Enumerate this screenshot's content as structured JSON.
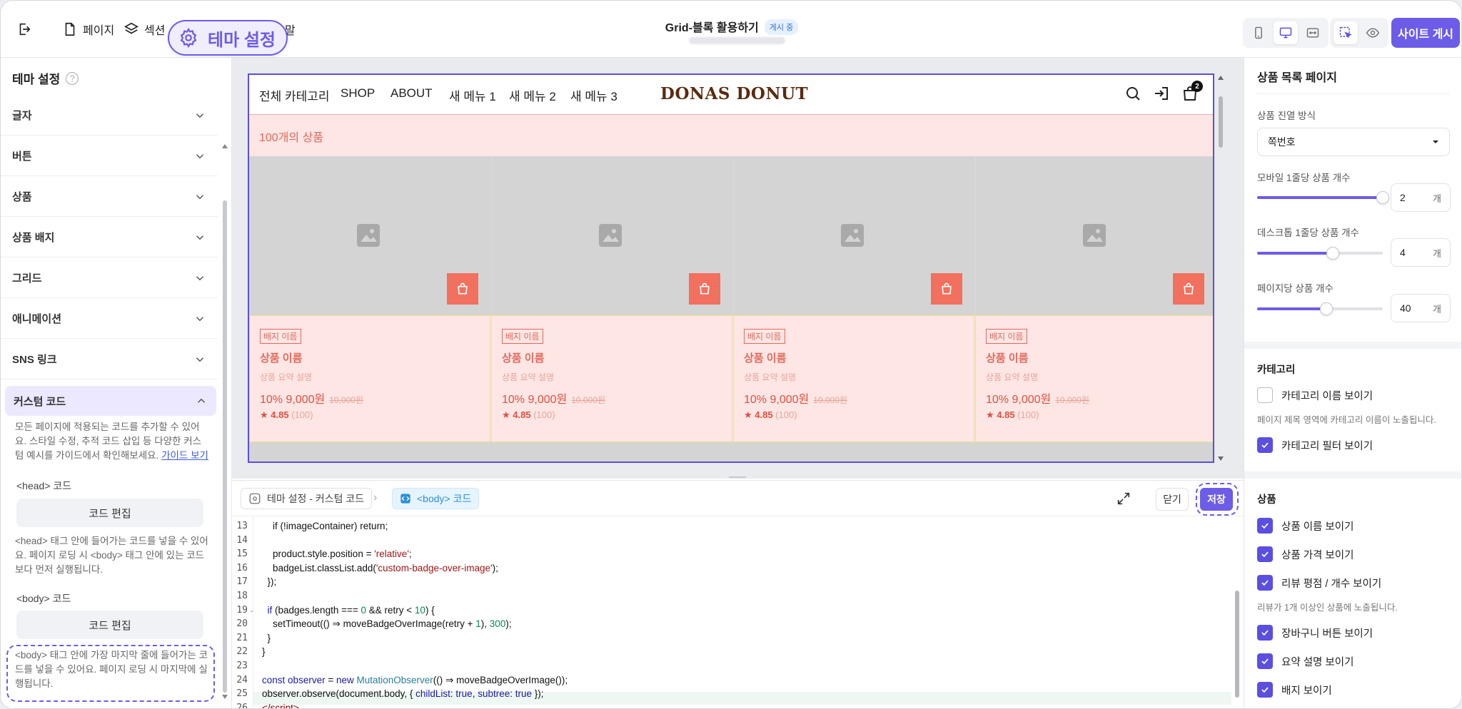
{
  "topbar": {
    "page_label": "페이지",
    "section_label": "섹션",
    "theme_label": "테마 설정",
    "hidden_label_tail": "말",
    "doc_title": "Grid-블록 활용하기",
    "doc_status": "게시 중",
    "publish_label": "사이트 게시"
  },
  "left": {
    "title": "테마 설정",
    "help": "?",
    "accordion": [
      "글자",
      "버튼",
      "상품",
      "상품 배지",
      "그리드",
      "애니메이션",
      "SNS 링크"
    ],
    "custom": {
      "label": "커스텀 코드",
      "desc": "모든 페이지에 적용되는 코드를 추가할 수 있어요. 스타일 수정, 추적 코드 삽입 등 다양한 커스텀 예시를 가이드에서 확인해보세요.",
      "guide_link": "가이드 보기",
      "head_label": "<head> 코드",
      "head_btn": "코드 편집",
      "head_desc": "<head> 태그 안에 들어가는 코드를 넣을 수 있어요. 페이지 로딩 시 <body> 태그 안에 있는 코드보다 먼저 실행됩니다.",
      "body_label": "<body> 코드",
      "body_btn": "코드 편집",
      "body_desc": "<body> 태그 안에 가장 마지막 줄에 들어가는 코드를 넣을 수 있어요. 페이지 로딩 시 마지막에 실행됩니다."
    }
  },
  "store": {
    "nav": [
      "전체 카테고리",
      "SHOP",
      "ABOUT",
      "새 메뉴 1",
      "새 메뉴 2",
      "새 메뉴 3"
    ],
    "logo": "DONAS DONUT",
    "cart_count": "2",
    "product_count": "100개의 상품",
    "products": [
      {
        "badge": "배지 이름",
        "name": "상품 이름",
        "desc": "상품 요약 설명",
        "price": "10% 9,000원",
        "orig": "10,000원",
        "rating": "★ 4.85",
        "reviews": "(100)"
      },
      {
        "badge": "배지 이름",
        "name": "상품 이름",
        "desc": "상품 요약 설명",
        "price": "10% 9,000원",
        "orig": "10,000원",
        "rating": "★ 4.85",
        "reviews": "(100)"
      },
      {
        "badge": "배지 이름",
        "name": "상품 이름",
        "desc": "상품 요약 설명",
        "price": "10% 9,000원",
        "orig": "10,000원",
        "rating": "★ 4.85",
        "reviews": "(100)"
      },
      {
        "badge": "배지 이름",
        "name": "상품 이름",
        "desc": "상품 요약 설명",
        "price": "10% 9,000원",
        "orig": "10,000원",
        "rating": "★ 4.85",
        "reviews": "(100)"
      }
    ]
  },
  "editor": {
    "crumb1": "테마 설정 - 커스텀 코드",
    "crumb_sep": "›",
    "crumb2": "<body> 코드",
    "close_label": "닫기",
    "save_label": "저장",
    "lines": [
      {
        "n": "13",
        "html": "    if (!imageContainer) return;"
      },
      {
        "n": "14",
        "html": ""
      },
      {
        "n": "15",
        "html": "    product.style.position = <span class='s'>'relative'</span>;"
      },
      {
        "n": "16",
        "html": "    badgeList.classList.add(<span class='s'>'custom-badge-over-image'</span>);"
      },
      {
        "n": "17",
        "html": "  });"
      },
      {
        "n": "18",
        "html": ""
      },
      {
        "n": "19",
        "html": "  <span class='k'>if</span> (badges.length === <span class='n'>0</span> &amp;&amp; retry &lt; <span class='n'>10</span>) {"
      },
      {
        "n": "20",
        "html": "    setTimeout(() ⇒ moveBadgeOverImage(retry + <span class='n'>1</span>), <span class='n'>300</span>);"
      },
      {
        "n": "21",
        "html": "  }"
      },
      {
        "n": "22",
        "html": "}"
      },
      {
        "n": "23",
        "html": ""
      },
      {
        "n": "24",
        "html": "<span class='k'>const</span> <span class='k'>observer</span> = <span class='k'>new</span> <span class='f'>MutationObserver</span>(() ⇒ moveBadgeOverImage());"
      },
      {
        "n": "25",
        "html": "observer.observe(document.body, { <span class='k'>childList</span>: <span class='k'>true</span>, <span class='k'>subtree</span>: <span class='k'>true</span> });"
      },
      {
        "n": "26",
        "html": "<span class='t'>&lt;/script&gt;</span>"
      }
    ]
  },
  "right": {
    "title": "상품 목록 페이지",
    "layout_label": "상품 진열 방식",
    "layout_value": "쪽번호",
    "mobile_label": "모바일 1줄당 상품 개수",
    "mobile_value": "2",
    "desktop_label": "데스크톱 1줄당 상품 개수",
    "desktop_value": "4",
    "perpage_label": "페이지당 상품 개수",
    "perpage_value": "40",
    "unit": "개",
    "category_title": "카테고리",
    "cat_name_label": "카테고리 이름 보이기",
    "cat_name_note": "페이지 제목 영역에 카테고리 이름이 노출됩니다.",
    "cat_filter_label": "카테고리 필터 보이기",
    "product_title": "상품",
    "show_name": "상품 이름 보이기",
    "show_price": "상품 가격 보이기",
    "show_review": "리뷰 평점 / 개수 보이기",
    "review_note": "리뷰가 1개 이상인 상품에 노출됩니다.",
    "show_cart": "장바구니 버튼 보이기",
    "show_summary": "요약 설명 보이기",
    "show_badge": "배지 보이기"
  },
  "controls": {
    "mobile_level": 1.0,
    "desktop_level": 0.6,
    "perpage_level": 0.55,
    "checkbox_states": [
      false,
      true,
      true,
      true,
      true,
      true,
      true,
      true
    ]
  },
  "colors": {
    "accent": "#6c5ce7",
    "store_bg": "#fde6e4",
    "store_red": "#f2705e"
  }
}
